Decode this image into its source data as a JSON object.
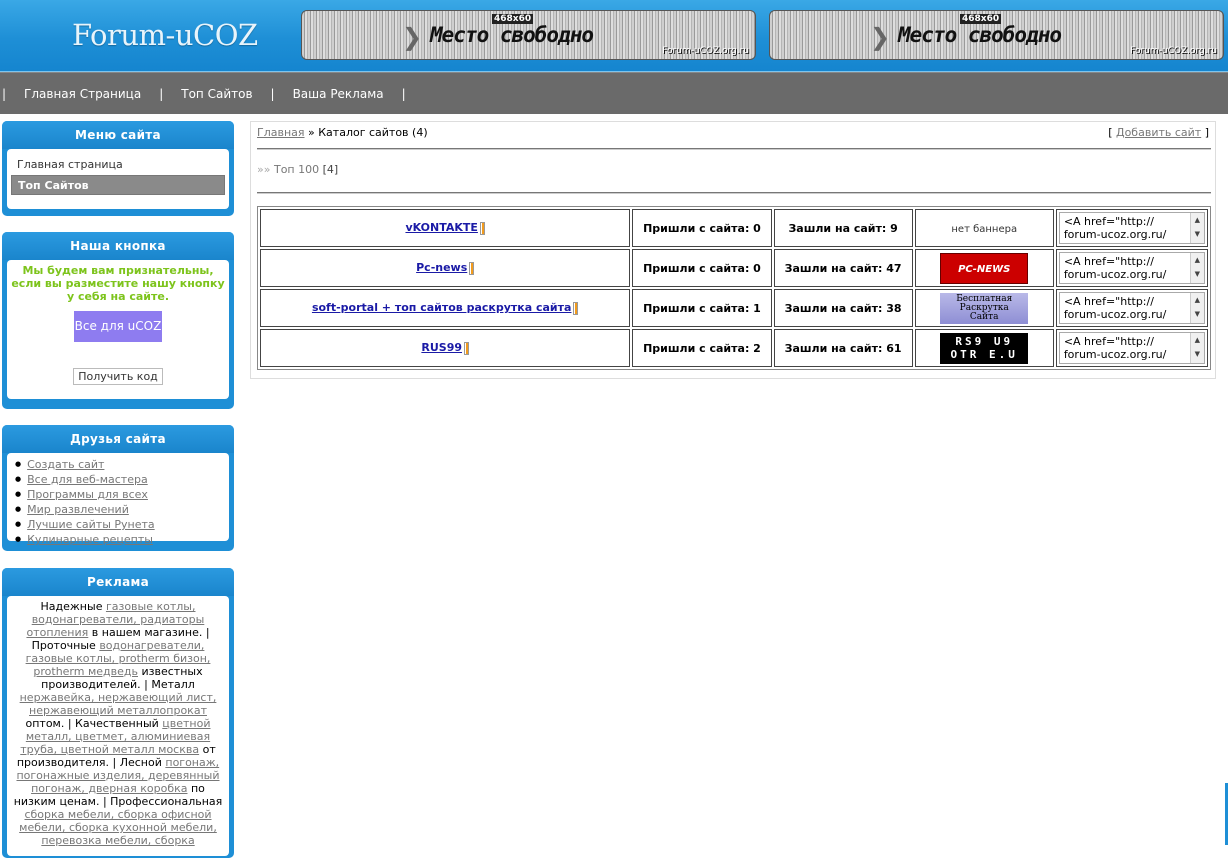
{
  "header": {
    "logo": "Forum-uCOZ",
    "banners": [
      {
        "size": "468x60",
        "text": "Место свободно",
        "site": "Forum-uCOZ.org.ru"
      },
      {
        "size": "468x60",
        "text": "Место свободно",
        "site": "Forum-uCOZ.org.ru"
      }
    ]
  },
  "nav": {
    "items": [
      "Главная Страница",
      "Топ Сайтов",
      "Ваша Реклама"
    ]
  },
  "sidebar": {
    "menu": {
      "title": "Меню сайта",
      "items": [
        "Главная страница",
        "Топ Сайтов"
      ]
    },
    "button_block": {
      "title": "Наша кнопка",
      "text": "Мы будем вам признательны, если вы разместите нашу кнопку у себя на сайте.",
      "button_text": "Все для uCOZ",
      "get_code": "Получить код"
    },
    "friends": {
      "title": "Друзья сайта",
      "links": [
        "Создать сайт",
        "Все для веб-мастера",
        "Программы для всех",
        "Мир развлечений",
        "Лучшие сайты Рунета",
        "Кулинарные рецепты"
      ]
    },
    "ads": {
      "title": "Реклама",
      "parts": [
        {
          "t": "Надежные ",
          "link": false
        },
        {
          "t": "газовые котлы, водонагреватели, радиаторы отопления",
          "link": true
        },
        {
          "t": " в нашем магазине. | Проточные ",
          "link": false
        },
        {
          "t": "водонагреватели, газовые котлы, protherm бизон, protherm медведь",
          "link": true
        },
        {
          "t": " известных производителей. | Металл ",
          "link": false
        },
        {
          "t": "нержавейка, нержавеющий лист, нержавеющий металлопрокат",
          "link": true
        },
        {
          "t": " оптом. | Качественный ",
          "link": false
        },
        {
          "t": "цветной металл, цветмет, алюминиевая труба, цветной металл москва",
          "link": true
        },
        {
          "t": " от производителя. | Лесной ",
          "link": false
        },
        {
          "t": "погонаж, погонажные изделия, деревянный погонаж, дверная коробка",
          "link": true
        },
        {
          "t": " по низким ценам. | Профессиональная ",
          "link": false
        },
        {
          "t": "сборка мебели, сборка офисной мебели, сборка кухонной мебели, перевозка мебели, сборка",
          "link": true
        }
      ]
    }
  },
  "main": {
    "breadcrumb_home": "Главная",
    "breadcrumb_sep": " » ",
    "breadcrumb_current": "Каталог сайтов (4)",
    "add_site_open": "[ ",
    "add_site": "Добавить сайт",
    "add_site_close": " ]",
    "top100_arrows": "»»",
    "top100_label": "Топ 100",
    "top100_count": "[4]",
    "rows": [
      {
        "name": "vKONTAKTE",
        "came_from": "Пришли с сайта: 0",
        "went_to": "Зашли на сайт: 9",
        "banner": "none",
        "banner_text": "нет баннера",
        "code": "<A href=\"http://\nforum-ucoz.org.ru/"
      },
      {
        "name": "Pc-news",
        "came_from": "Пришли с сайта: 0",
        "went_to": "Зашли на сайт: 47",
        "banner": "pcnews",
        "banner_text": "PC-NEWS",
        "code": "<A href=\"http://\nforum-ucoz.org.ru/"
      },
      {
        "name": "soft-portal + топ сайтов раскрутка сайта",
        "came_from": "Пришли с сайта: 1",
        "went_to": "Зашли на сайт: 38",
        "banner": "soft",
        "banner_text": "Бесплатная\nРаскрутка\nСайта",
        "code": "<A href=\"http://\nforum-ucoz.org.ru/"
      },
      {
        "name": "RUS99",
        "came_from": "Пришли с сайта: 2",
        "went_to": "Зашли на сайт: 61",
        "banner": "rus99",
        "banner_text": "RS9 U9\nOTR E.U",
        "code": "<A href=\"http://\nforum-ucoz.org.ru/"
      }
    ]
  },
  "colors": {
    "accent": "#1e8fd6",
    "nav": "#6a6a6a",
    "link": "#1a1aa6",
    "green_text": "#7dc41c"
  }
}
